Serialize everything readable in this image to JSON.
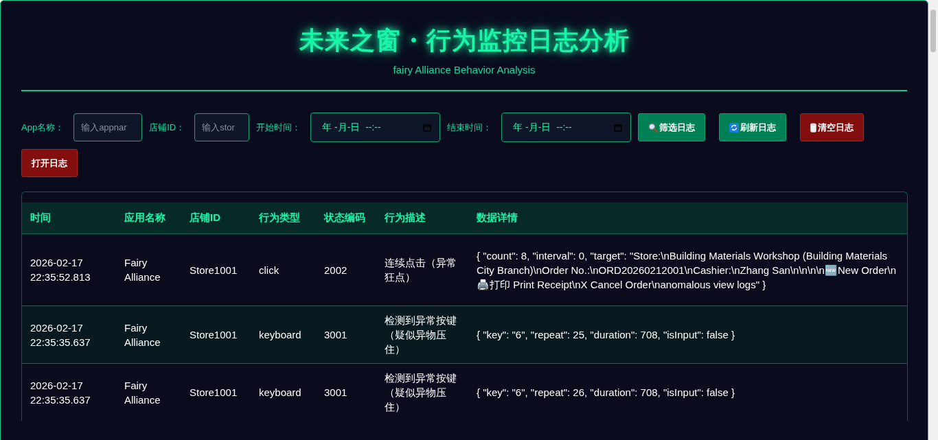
{
  "header": {
    "title": "未来之窗・行为监控日志分析",
    "subtitle": "fairy Alliance Behavior Analysis"
  },
  "filters": [
    {
      "kind": "text",
      "label": "App名称：",
      "placeholder": "输入appnar"
    },
    {
      "kind": "text",
      "label": "店铺ID：",
      "placeholder": "输入stor"
    },
    {
      "kind": "date",
      "label": "开始时间：",
      "value": "年 -月-日  --:--"
    },
    {
      "kind": "date",
      "label": "结束时间：",
      "value": "年 -月-日  --:--"
    }
  ],
  "buttons": [
    {
      "label": "筛选日志",
      "kind": "primary"
    },
    {
      "label": "刷新日志",
      "kind": "primary"
    },
    {
      "label": "清空日志",
      "kind": "danger"
    },
    {
      "label": "打开日志",
      "kind": "danger"
    }
  ],
  "table": {
    "columns": [
      "时间",
      "应用名称",
      "店铺ID",
      "行为类型",
      "状态编码",
      "行为描述",
      "数据详情"
    ],
    "rows": [
      [
        "2026-02-17 22:35:52.813",
        "Fairy Alliance",
        "Store1001",
        "click",
        "2002",
        "连续点击（异常狂点）",
        "{ \"count\": 8, \"interval\": 0, \"target\": \"Store:\\nBuilding Materials Workshop (Building Materials City Branch)\\nOrder No.:\\nORD20260212001\\nCashier:\\nZhang San\\n\\n\\n\\n🆕New Order\\n🖨️打印 Print Receipt\\nX Cancel Order\\nanomalous view logs\" }"
      ],
      [
        "2026-02-17 22:35:35.637",
        "Fairy Alliance",
        "Store1001",
        "keyboard",
        "3001",
        "检测到异常按键（疑似异物压住）",
        "{ \"key\": \"6\", \"repeat\": 25, \"duration\": 708, \"isInput\": false }"
      ],
      [
        "2026-02-17 22:35:35.637",
        "Fairy Alliance",
        "Store1001",
        "keyboard",
        "3001",
        "检测到异常按键（疑似异物压住）",
        "{ \"key\": \"6\", \"repeat\": 26, \"duration\": 708, \"isInput\": false }"
      ]
    ]
  }
}
